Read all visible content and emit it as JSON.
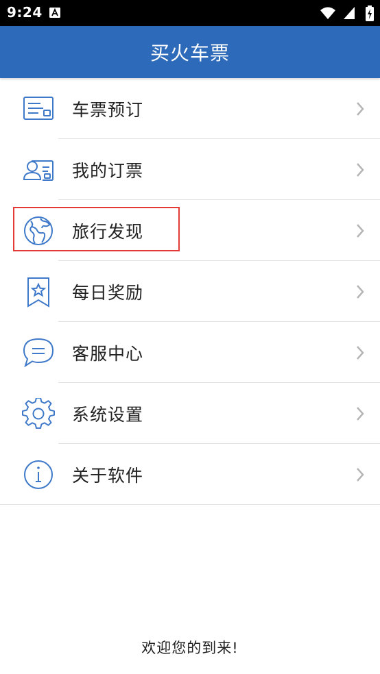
{
  "status_bar": {
    "time": "9:24",
    "icons": [
      "notification-a-icon",
      "wifi-icon",
      "signal-icon",
      "battery-charging-icon"
    ]
  },
  "app_bar": {
    "title": "买火车票"
  },
  "menu": {
    "items": [
      {
        "label": "车票预订",
        "icon": "ticket-card-icon"
      },
      {
        "label": "我的订票",
        "icon": "user-card-icon"
      },
      {
        "label": "旅行发现",
        "icon": "globe-icon",
        "highlighted": true
      },
      {
        "label": "每日奖励",
        "icon": "star-bookmark-icon"
      },
      {
        "label": "客服中心",
        "icon": "chat-bubble-icon"
      },
      {
        "label": "系统设置",
        "icon": "gear-icon"
      },
      {
        "label": "关于软件",
        "icon": "info-icon"
      }
    ]
  },
  "footer": {
    "text": "欢迎您的到来!"
  },
  "colors": {
    "accent": "#2d6ab9",
    "icon": "#3d78c9",
    "highlight": "#e53935"
  }
}
